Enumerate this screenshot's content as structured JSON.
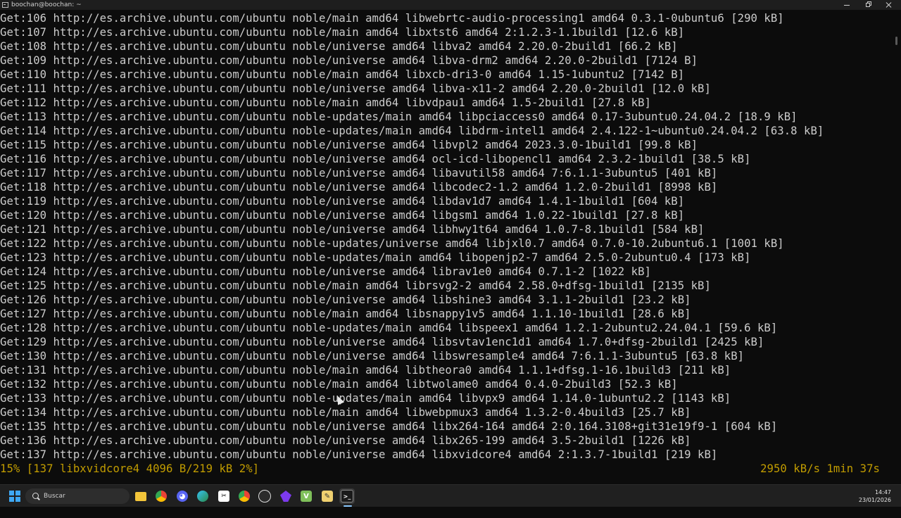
{
  "window": {
    "title": "boochan@boochan: ~"
  },
  "terminal": {
    "lines": [
      "Get:106 http://es.archive.ubuntu.com/ubuntu noble/main amd64 libwebrtc-audio-processing1 amd64 0.3.1-0ubuntu6 [290 kB]",
      "Get:107 http://es.archive.ubuntu.com/ubuntu noble/main amd64 libxtst6 amd64 2:1.2.3-1.1build1 [12.6 kB]",
      "Get:108 http://es.archive.ubuntu.com/ubuntu noble/universe amd64 libva2 amd64 2.20.0-2build1 [66.2 kB]",
      "Get:109 http://es.archive.ubuntu.com/ubuntu noble/universe amd64 libva-drm2 amd64 2.20.0-2build1 [7124 B]",
      "Get:110 http://es.archive.ubuntu.com/ubuntu noble/main amd64 libxcb-dri3-0 amd64 1.15-1ubuntu2 [7142 B]",
      "Get:111 http://es.archive.ubuntu.com/ubuntu noble/universe amd64 libva-x11-2 amd64 2.20.0-2build1 [12.0 kB]",
      "Get:112 http://es.archive.ubuntu.com/ubuntu noble/main amd64 libvdpau1 amd64 1.5-2build1 [27.8 kB]",
      "Get:113 http://es.archive.ubuntu.com/ubuntu noble-updates/main amd64 libpciaccess0 amd64 0.17-3ubuntu0.24.04.2 [18.9 kB]",
      "Get:114 http://es.archive.ubuntu.com/ubuntu noble-updates/main amd64 libdrm-intel1 amd64 2.4.122-1~ubuntu0.24.04.2 [63.8 kB]",
      "Get:115 http://es.archive.ubuntu.com/ubuntu noble/universe amd64 libvpl2 amd64 2023.3.0-1build1 [99.8 kB]",
      "Get:116 http://es.archive.ubuntu.com/ubuntu noble/universe amd64 ocl-icd-libopencl1 amd64 2.3.2-1build1 [38.5 kB]",
      "Get:117 http://es.archive.ubuntu.com/ubuntu noble/universe amd64 libavutil58 amd64 7:6.1.1-3ubuntu5 [401 kB]",
      "Get:118 http://es.archive.ubuntu.com/ubuntu noble/universe amd64 libcodec2-1.2 amd64 1.2.0-2build1 [8998 kB]",
      "Get:119 http://es.archive.ubuntu.com/ubuntu noble/universe amd64 libdav1d7 amd64 1.4.1-1build1 [604 kB]",
      "Get:120 http://es.archive.ubuntu.com/ubuntu noble/universe amd64 libgsm1 amd64 1.0.22-1build1 [27.8 kB]",
      "Get:121 http://es.archive.ubuntu.com/ubuntu noble/universe amd64 libhwy1t64 amd64 1.0.7-8.1build1 [584 kB]",
      "Get:122 http://es.archive.ubuntu.com/ubuntu noble-updates/universe amd64 libjxl0.7 amd64 0.7.0-10.2ubuntu6.1 [1001 kB]",
      "Get:123 http://es.archive.ubuntu.com/ubuntu noble-updates/main amd64 libopenjp2-7 amd64 2.5.0-2ubuntu0.4 [173 kB]",
      "Get:124 http://es.archive.ubuntu.com/ubuntu noble/universe amd64 librav1e0 amd64 0.7.1-2 [1022 kB]",
      "Get:125 http://es.archive.ubuntu.com/ubuntu noble/main amd64 librsvg2-2 amd64 2.58.0+dfsg-1build1 [2135 kB]",
      "Get:126 http://es.archive.ubuntu.com/ubuntu noble/universe amd64 libshine3 amd64 3.1.1-2build1 [23.2 kB]",
      "Get:127 http://es.archive.ubuntu.com/ubuntu noble/main amd64 libsnappy1v5 amd64 1.1.10-1build1 [28.6 kB]",
      "Get:128 http://es.archive.ubuntu.com/ubuntu noble-updates/main amd64 libspeex1 amd64 1.2.1-2ubuntu2.24.04.1 [59.6 kB]",
      "Get:129 http://es.archive.ubuntu.com/ubuntu noble/universe amd64 libsvtav1enc1d1 amd64 1.7.0+dfsg-2build1 [2425 kB]",
      "Get:130 http://es.archive.ubuntu.com/ubuntu noble/universe amd64 libswresample4 amd64 7:6.1.1-3ubuntu5 [63.8 kB]",
      "Get:131 http://es.archive.ubuntu.com/ubuntu noble/main amd64 libtheora0 amd64 1.1.1+dfsg.1-16.1build3 [211 kB]",
      "Get:132 http://es.archive.ubuntu.com/ubuntu noble/main amd64 libtwolame0 amd64 0.4.0-2build3 [52.3 kB]",
      "Get:133 http://es.archive.ubuntu.com/ubuntu noble-updates/main amd64 libvpx9 amd64 1.14.0-1ubuntu2.2 [1143 kB]",
      "Get:134 http://es.archive.ubuntu.com/ubuntu noble/main amd64 libwebpmux3 amd64 1.3.2-0.4build3 [25.7 kB]",
      "Get:135 http://es.archive.ubuntu.com/ubuntu noble/universe amd64 libx264-164 amd64 2:0.164.3108+git31e19f9-1 [604 kB]",
      "Get:136 http://es.archive.ubuntu.com/ubuntu noble/universe amd64 libx265-199 amd64 3.5-2build1 [1226 kB]",
      "Get:137 http://es.archive.ubuntu.com/ubuntu noble/universe amd64 libxvidcore4 amd64 2:1.3.7-1build1 [219 kB]"
    ],
    "status_left": "15% [137 libxvidcore4 4096 B/219 kB 2%]",
    "status_right": "2950 kB/s 1min 37s",
    "status_color": "#c19c00",
    "text_color": "#cccccc",
    "background_color": "#0c0c0c"
  },
  "taskbar": {
    "search_placeholder": "Buscar",
    "apps": [
      {
        "icon": "file-explorer-icon"
      },
      {
        "icon": "chrome-icon"
      },
      {
        "icon": "discord-icon"
      },
      {
        "icon": "edge-icon"
      },
      {
        "icon": "capcut-icon"
      },
      {
        "icon": "chrome-profile-icon"
      },
      {
        "icon": "obs-icon"
      },
      {
        "icon": "obsidian-icon"
      },
      {
        "icon": "visual-studio-icon"
      },
      {
        "icon": "notepad-icon"
      },
      {
        "icon": "terminal-icon"
      }
    ],
    "clock_time": "14:47",
    "clock_date": "23/01/2026"
  }
}
